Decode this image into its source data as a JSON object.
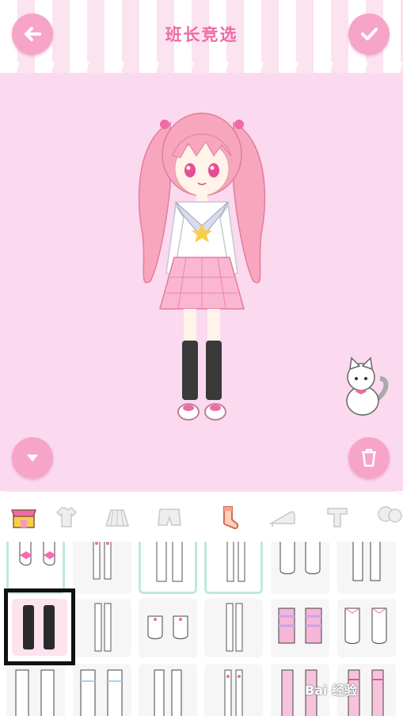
{
  "header": {
    "title": "班长竞选"
  },
  "buttons": {
    "back": "back-arrow-icon",
    "confirm": "check-icon",
    "collapse": "chevron-down-icon",
    "trash": "trash-icon"
  },
  "tabs": [
    {
      "id": "shop",
      "icon": "shop-icon"
    },
    {
      "id": "tops",
      "icon": "shirt-icon"
    },
    {
      "id": "skirts",
      "icon": "skirt-icon"
    },
    {
      "id": "shorts",
      "icon": "shorts-icon"
    },
    {
      "id": "socks",
      "icon": "sock-icon",
      "active": true
    },
    {
      "id": "shoes",
      "icon": "high-heel-icon"
    },
    {
      "id": "hats",
      "icon": "hat-icon"
    },
    {
      "id": "accessories",
      "icon": "balloon-icon"
    }
  ],
  "items_grid": {
    "selected": "black-knee-socks",
    "rows": [
      [
        "pink-bow-socks",
        "white-tights",
        "white-knee-socks",
        "white-tights-2",
        "slouch-socks",
        "white-thigh-socks"
      ],
      [
        "black-knee-socks",
        "white-tights-3",
        "short-ruffle-socks",
        "white-tights-4",
        "pink-striped-socks",
        "white-frill-socks"
      ],
      [
        "white-long-socks",
        "slouch-leg-warmers",
        "white-knee-socks-2",
        "white-tights-5",
        "pink-dot-socks",
        "pink-striped-long"
      ]
    ]
  },
  "watermark": "Bai 经验",
  "colors": {
    "accent": "#f06aa6",
    "button": "#f7a4c9",
    "stage": "#fbd9ee",
    "selected_border": "#bfe9dc"
  }
}
